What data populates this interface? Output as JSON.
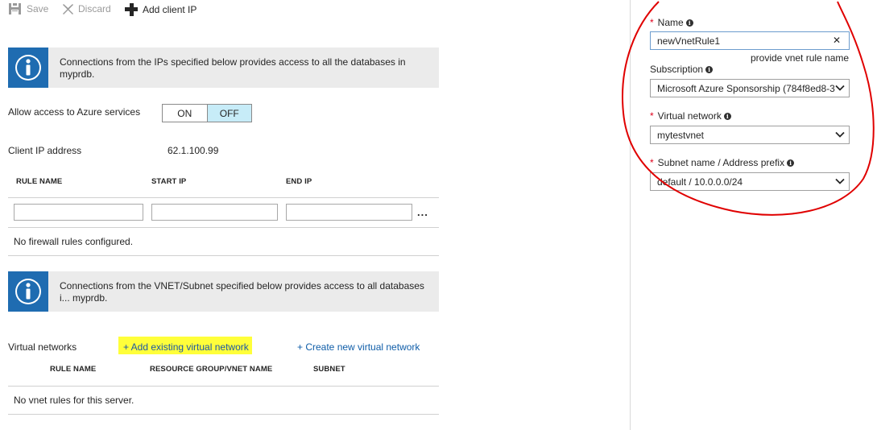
{
  "toolbar": {
    "save_label": "Save",
    "discard_label": "Discard",
    "add_client_ip_label": "Add client IP"
  },
  "banner1": {
    "text": "Connections from the IPs specified below provides access to all the databases in myprdb."
  },
  "azure_access": {
    "label": "Allow access to Azure services",
    "on_label": "ON",
    "off_label": "OFF",
    "selected": "OFF"
  },
  "client_ip": {
    "label": "Client IP address",
    "value": "62.1.100.99"
  },
  "firewall_table": {
    "columns": [
      "RULE NAME",
      "START IP",
      "END IP"
    ],
    "more_label": "...",
    "empty_text": "No firewall rules configured."
  },
  "banner2": {
    "text": "Connections from the VNET/Subnet specified below provides access to all databases i... myprdb."
  },
  "vnet": {
    "label": "Virtual networks",
    "add_existing_link": "+ Add existing virtual network",
    "create_new_link": "+ Create new virtual network",
    "columns": [
      "RULE NAME",
      "RESOURCE GROUP/VNET NAME",
      "SUBNET"
    ],
    "empty_text": "No vnet rules for this server."
  },
  "panel": {
    "name_label": "Name",
    "name_value": "newVnetRule1",
    "name_hint": "provide vnet rule name",
    "subscription_label": "Subscription",
    "subscription_value": "Microsoft Azure Sponsorship (784f8ed8-3",
    "vnet_label": "Virtual network",
    "vnet_value": "mytestvnet",
    "subnet_label": "Subnet name / Address prefix",
    "subnet_value": "default / 10.0.0.0/24",
    "required_marker": "*",
    "info_glyph": "i",
    "clear_glyph": "✕"
  },
  "colors": {
    "info_blue": "#1f6cb1",
    "toggle_selected": "#c7ecf8",
    "link": "#0f5da8",
    "highlight": "#ffff3a",
    "annotation_red": "#e00000",
    "required": "#e0001b"
  }
}
